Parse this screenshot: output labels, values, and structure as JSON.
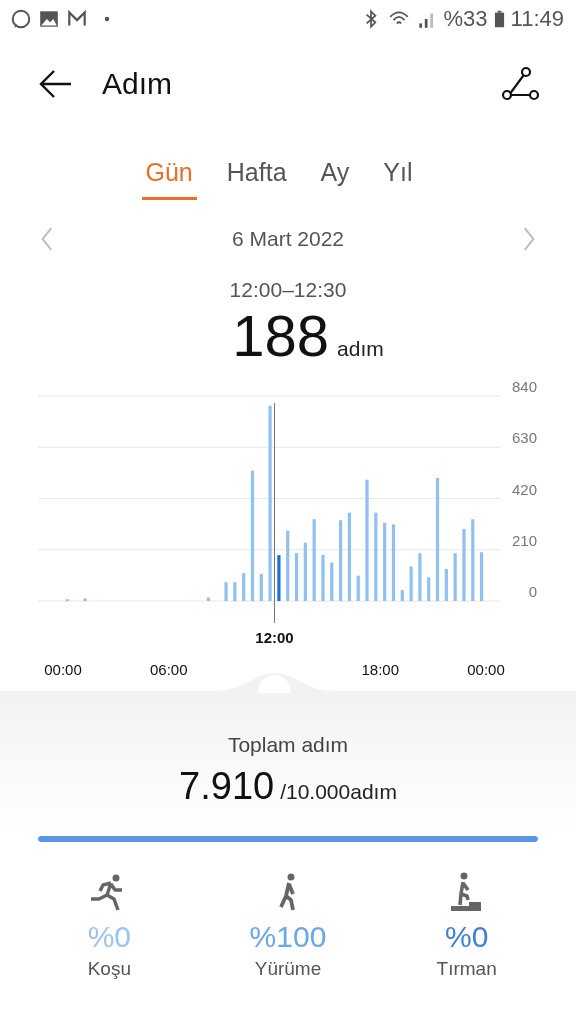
{
  "status_bar": {
    "battery": "%33",
    "time": "11:49"
  },
  "header": {
    "title": "Adım"
  },
  "tabs": [
    {
      "label": "Gün",
      "selected": true
    },
    {
      "label": "Hafta",
      "selected": false
    },
    {
      "label": "Ay",
      "selected": false
    },
    {
      "label": "Yıl",
      "selected": false
    }
  ],
  "date": "6 Mart 2022",
  "selection": {
    "range": "12:00–12:30",
    "value": "188",
    "unit": "adım"
  },
  "chart": {
    "chart_data": {
      "type": "bar",
      "x": [
        0,
        0.5,
        1,
        1.5,
        2,
        2.5,
        3,
        3.5,
        4,
        4.5,
        5,
        5.5,
        6,
        6.5,
        7,
        7.5,
        8,
        8.5,
        9,
        9.5,
        10,
        10.5,
        11,
        11.5,
        12,
        12.5,
        13,
        13.5,
        14,
        14.5,
        15,
        15.5,
        16,
        16.5,
        17,
        17.5,
        18,
        18.5,
        19,
        19.5,
        20,
        20.5,
        21,
        21.5,
        22,
        22.5,
        23,
        23.5
      ],
      "values": [
        7,
        0,
        11,
        0,
        0,
        0,
        0,
        0,
        0,
        0,
        0,
        0,
        0,
        0,
        0,
        0,
        14,
        0,
        77,
        77,
        114,
        534,
        111,
        800,
        188,
        288,
        196,
        239,
        335,
        189,
        158,
        331,
        362,
        104,
        497,
        362,
        320,
        314,
        45,
        142,
        196,
        97,
        504,
        131,
        196,
        295,
        335,
        200
      ],
      "xlim": [
        0,
        24
      ],
      "ylim": [
        0,
        840
      ],
      "yticks": [
        0,
        210,
        420,
        630,
        840
      ],
      "grid": true,
      "xticks": [
        {
          "value": 0,
          "label": "00:00"
        },
        {
          "value": 6,
          "label": "06:00"
        },
        {
          "value": 18,
          "label": "18:00"
        },
        {
          "value": 24,
          "label": "00:00"
        }
      ],
      "annotations": [
        {
          "x": 12,
          "y": 0,
          "text": "12:00"
        }
      ],
      "ref_lines": [
        {
          "axis": "x",
          "value": 12
        }
      ]
    }
  },
  "summary": {
    "label": "Toplam adım",
    "value": "7.910",
    "goal": "/10.000adım",
    "level": 1
  },
  "activities": [
    {
      "kind": "run",
      "percent": "%0",
      "label": "Koşu",
      "color": "#9cc3ee"
    },
    {
      "kind": "walk",
      "percent": "%100",
      "label": "Yürüme",
      "color": "#6aa6ea"
    },
    {
      "kind": "climb",
      "percent": "%0",
      "label": "Tırman",
      "color": "#3f7fd6"
    }
  ]
}
